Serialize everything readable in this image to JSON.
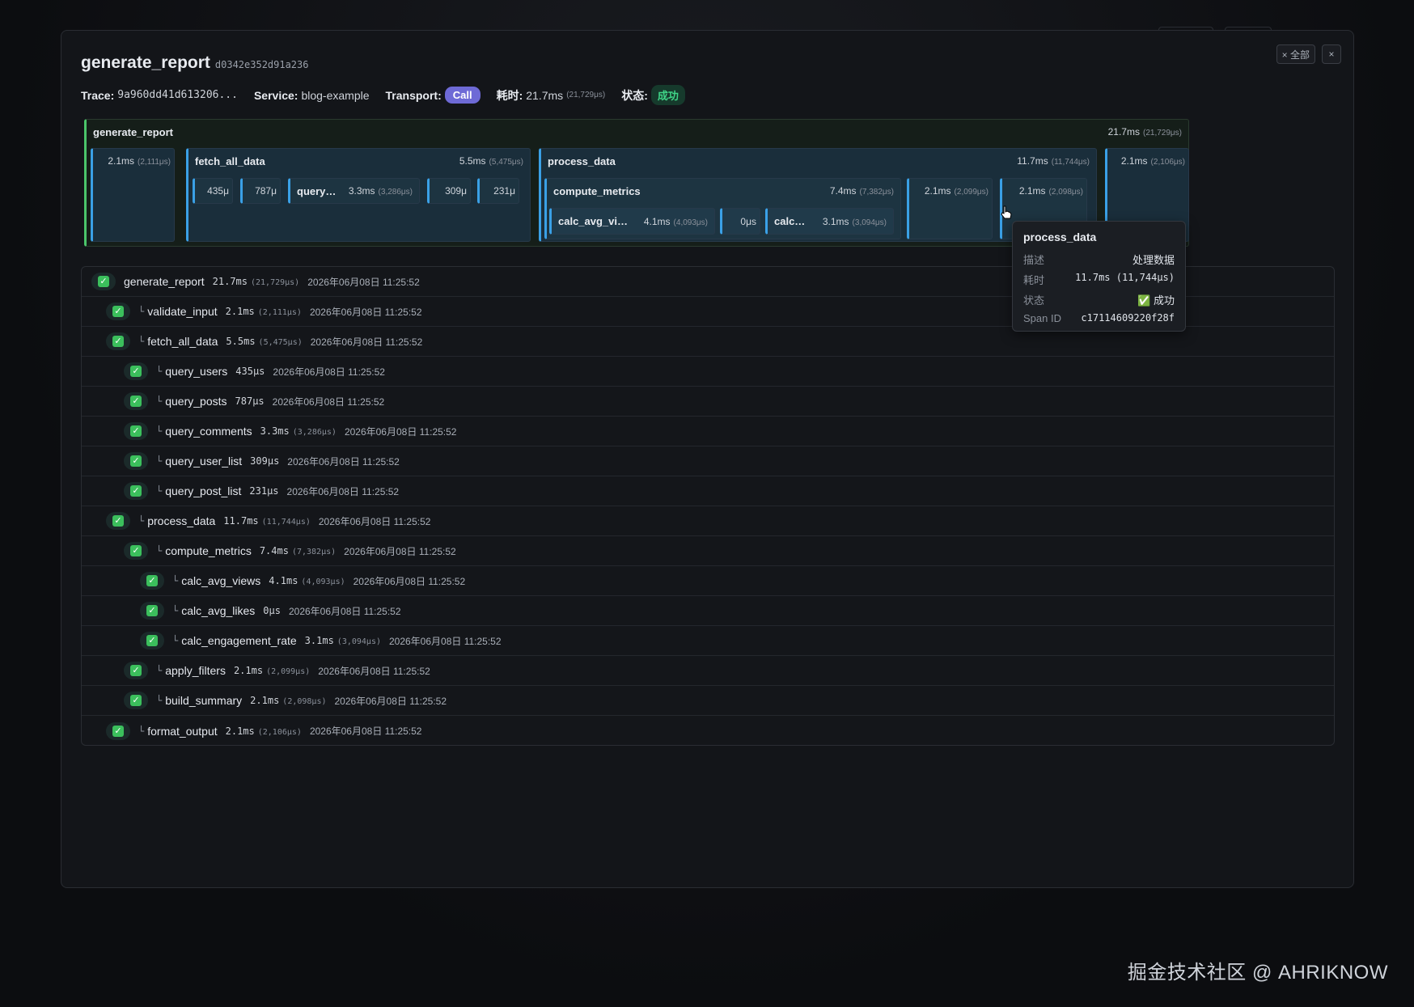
{
  "modal": {
    "title": "generate_report",
    "trace_short_id": "d0342e352d91a236",
    "clear_all_label": "× 全部",
    "close_label": "×"
  },
  "meta": {
    "trace_label": "Trace:",
    "trace_value": "9a960dd41d613206...",
    "service_label": "Service:",
    "service_value": "blog-example",
    "transport_label": "Transport:",
    "transport_value": "Call",
    "duration_label": "耗时:",
    "duration_value": "21.7ms",
    "duration_us": "(21,729μs)",
    "status_label": "状态:",
    "status_value": "成功"
  },
  "flame": {
    "generate_report": {
      "name": "generate_report",
      "dur": "21.7ms",
      "us": "(21,729μs)"
    },
    "validate_input": {
      "name": "",
      "dur": "2.1ms",
      "us": "(2,111μs)"
    },
    "fetch_all_data": {
      "name": "fetch_all_data",
      "dur": "5.5ms",
      "us": "(5,475μs)"
    },
    "query_users": {
      "dur": "435μ"
    },
    "query_posts": {
      "dur": "787μ"
    },
    "query_comments": {
      "name": "query…",
      "dur": "3.3ms",
      "us": "(3,286μs)"
    },
    "query_user_list": {
      "dur": "309μ"
    },
    "query_post_list": {
      "dur": "231μ"
    },
    "process_data": {
      "name": "process_data",
      "dur": "11.7ms",
      "us": "(11,744μs)"
    },
    "compute_metrics": {
      "name": "compute_metrics",
      "dur": "7.4ms",
      "us": "(7,382μs)"
    },
    "calc_avg_views": {
      "name": "calc_avg_vi…",
      "dur": "4.1ms",
      "us": "(4,093μs)"
    },
    "calc_avg_likes": {
      "dur": "0μs"
    },
    "calc_engagement_rate": {
      "name": "calc…",
      "dur": "3.1ms",
      "us": "(3,094μs)"
    },
    "apply_filters": {
      "dur": "2.1ms",
      "us": "(2,099μs)"
    },
    "build_summary": {
      "dur": "2.1ms",
      "us": "(2,098μs)"
    },
    "format_output": {
      "dur": "2.1ms",
      "us": "(2,106μs)"
    }
  },
  "spans": [
    {
      "name": "generate_report",
      "dur": "21.7ms",
      "us": "(21,729μs)",
      "ts": "2026年06月08日 11:25:52",
      "depth": 0
    },
    {
      "name": "validate_input",
      "dur": "2.1ms",
      "us": "(2,111μs)",
      "ts": "2026年06月08日 11:25:52",
      "depth": 1
    },
    {
      "name": "fetch_all_data",
      "dur": "5.5ms",
      "us": "(5,475μs)",
      "ts": "2026年06月08日 11:25:52",
      "depth": 1
    },
    {
      "name": "query_users",
      "dur": "435μs",
      "us": "",
      "ts": "2026年06月08日 11:25:52",
      "depth": 2
    },
    {
      "name": "query_posts",
      "dur": "787μs",
      "us": "",
      "ts": "2026年06月08日 11:25:52",
      "depth": 2
    },
    {
      "name": "query_comments",
      "dur": "3.3ms",
      "us": "(3,286μs)",
      "ts": "2026年06月08日 11:25:52",
      "depth": 2
    },
    {
      "name": "query_user_list",
      "dur": "309μs",
      "us": "",
      "ts": "2026年06月08日 11:25:52",
      "depth": 2
    },
    {
      "name": "query_post_list",
      "dur": "231μs",
      "us": "",
      "ts": "2026年06月08日 11:25:52",
      "depth": 2
    },
    {
      "name": "process_data",
      "dur": "11.7ms",
      "us": "(11,744μs)",
      "ts": "2026年06月08日 11:25:52",
      "depth": 1
    },
    {
      "name": "compute_metrics",
      "dur": "7.4ms",
      "us": "(7,382μs)",
      "ts": "2026年06月08日 11:25:52",
      "depth": 2
    },
    {
      "name": "calc_avg_views",
      "dur": "4.1ms",
      "us": "(4,093μs)",
      "ts": "2026年06月08日 11:25:52",
      "depth": 3
    },
    {
      "name": "calc_avg_likes",
      "dur": "0μs",
      "us": "",
      "ts": "2026年06月08日 11:25:52",
      "depth": 3
    },
    {
      "name": "calc_engagement_rate",
      "dur": "3.1ms",
      "us": "(3,094μs)",
      "ts": "2026年06月08日 11:25:52",
      "depth": 3
    },
    {
      "name": "apply_filters",
      "dur": "2.1ms",
      "us": "(2,099μs)",
      "ts": "2026年06月08日 11:25:52",
      "depth": 2
    },
    {
      "name": "build_summary",
      "dur": "2.1ms",
      "us": "(2,098μs)",
      "ts": "2026年06月08日 11:25:52",
      "depth": 2
    },
    {
      "name": "format_output",
      "dur": "2.1ms",
      "us": "(2,106μs)",
      "ts": "2026年06月08日 11:25:52",
      "depth": 1
    }
  ],
  "tree_glyph": "└",
  "check_glyph": "✓",
  "tooltip": {
    "title": "process_data",
    "desc_label": "描述",
    "desc_value": "处理数据",
    "dur_label": "耗时",
    "dur_value": "11.7ms (11,744μs)",
    "status_label": "状态",
    "status_value": "✅ 成功",
    "span_label": "Span ID",
    "span_value": "c17114609220f28f"
  },
  "watermark": "掘金技术社区 @ AHRIKNOW",
  "colors": {
    "accent_blue": "#3aa0e6",
    "root_green": "#4bc56a",
    "call_purple": "#6e6ad6",
    "success_green": "#3fd487"
  }
}
